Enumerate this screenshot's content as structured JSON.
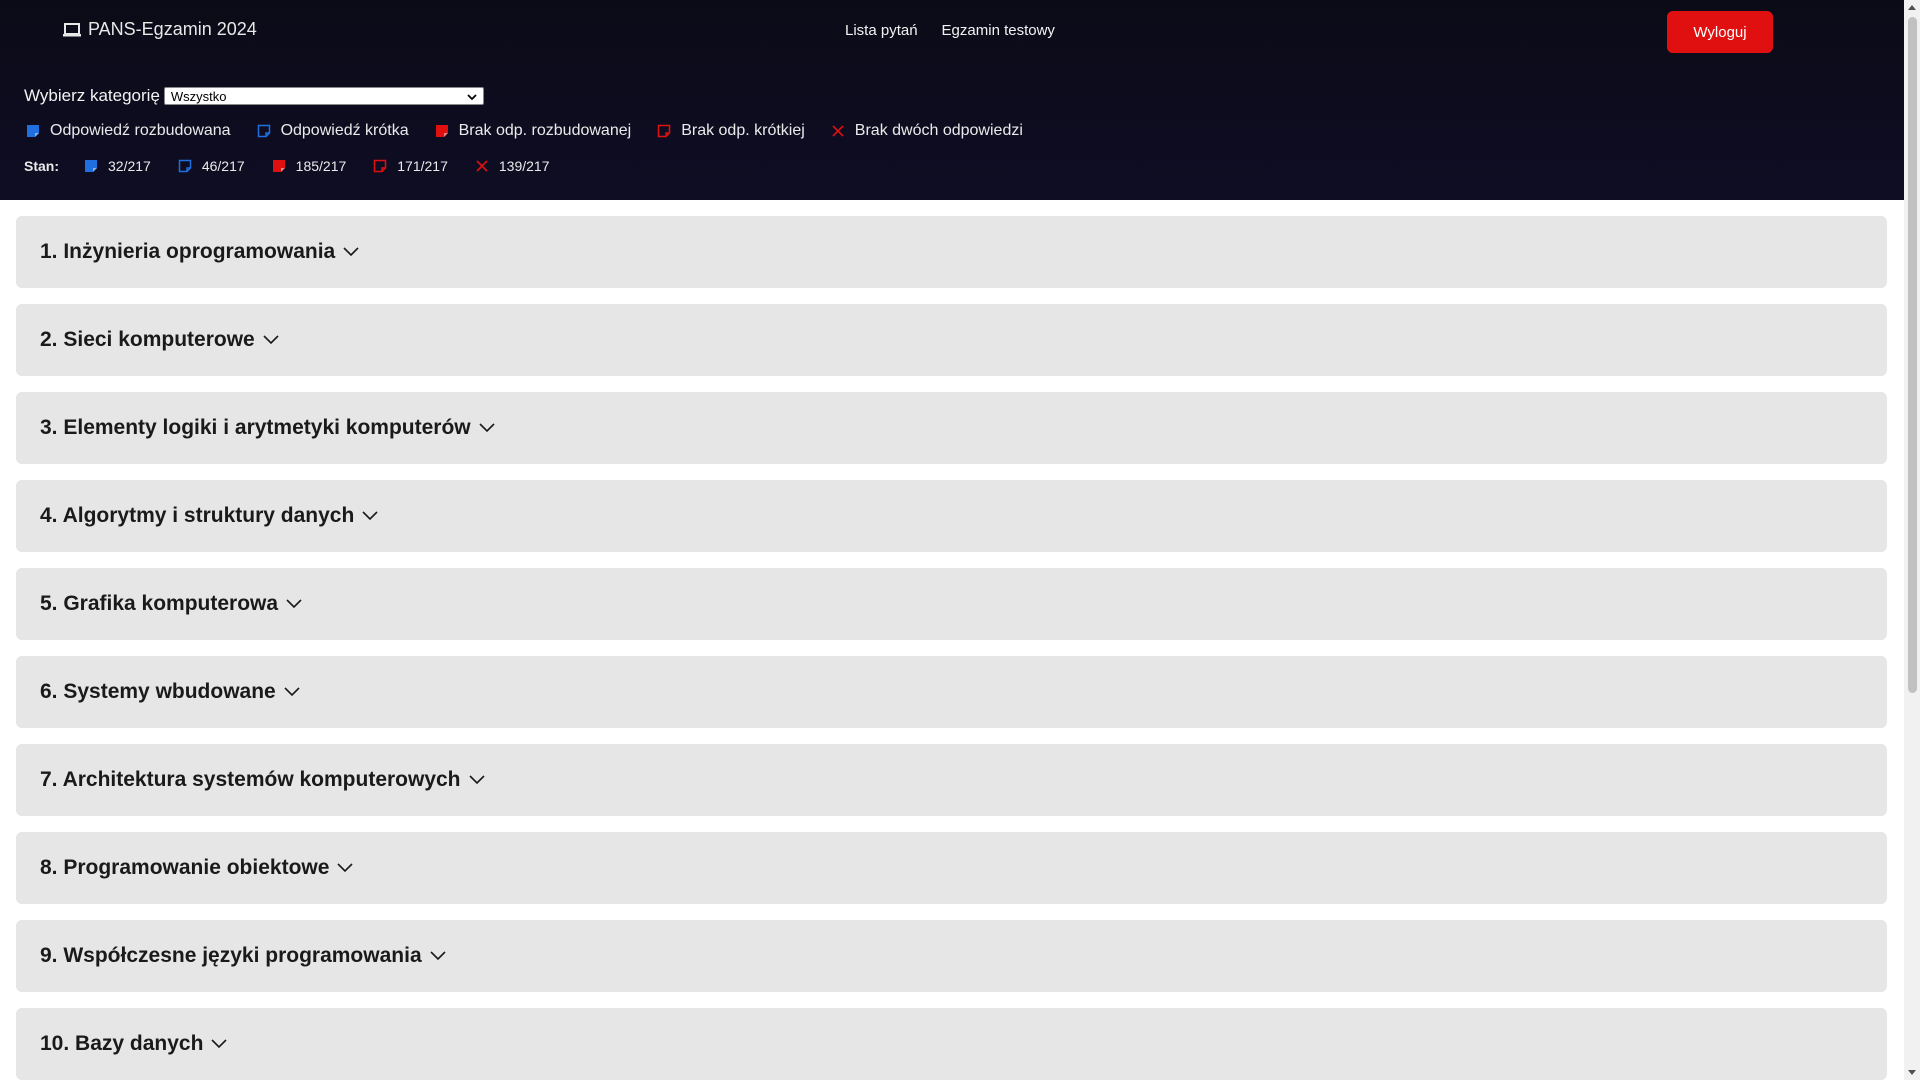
{
  "app": {
    "title": "PANS-Egzamin 2024",
    "icon": "laptop-icon"
  },
  "nav": {
    "items": [
      "Lista pytań",
      "Egzamin testowy"
    ]
  },
  "logout": {
    "label": "Wyloguj",
    "color": "#e01010"
  },
  "category": {
    "label": "Wybierz kategorię",
    "selected": "Wszystko"
  },
  "legend": [
    {
      "icon": "note-filled-blue-icon",
      "label": "Odpowiedź rozbudowana",
      "color": "#1f6fe0"
    },
    {
      "icon": "note-outline-blue-icon",
      "label": "Odpowiedź krótka",
      "color": "#1f6fe0"
    },
    {
      "icon": "note-filled-red-icon",
      "label": "Brak odp. rozbudowanej",
      "color": "#e01010"
    },
    {
      "icon": "note-outline-red-icon",
      "label": "Brak odp. krótkiej",
      "color": "#e01010"
    },
    {
      "icon": "x-red-icon",
      "label": "Brak dwóch odpowiedzi",
      "color": "#e01010"
    }
  ],
  "stats": {
    "label": "Stan:",
    "items": [
      {
        "icon": "note-filled-blue-icon",
        "value": "32/217"
      },
      {
        "icon": "note-outline-blue-icon",
        "value": "46/217"
      },
      {
        "icon": "note-filled-red-icon",
        "value": "185/217"
      },
      {
        "icon": "note-outline-red-icon",
        "value": "171/217"
      },
      {
        "icon": "x-red-icon",
        "value": "139/217"
      }
    ]
  },
  "sections": [
    "1. Inżynieria oprogramowania",
    "2. Sieci komputerowe",
    "3. Elementy logiki i arytmetyki komputerów",
    "4. Algorytmy i struktury danych",
    "5. Grafika komputerowa",
    "6. Systemy wbudowane",
    "7. Architektura systemów komputerowych",
    "8. Programowanie obiektowe",
    "9. Współczesne języki programowania",
    "10. Bazy danych"
  ]
}
